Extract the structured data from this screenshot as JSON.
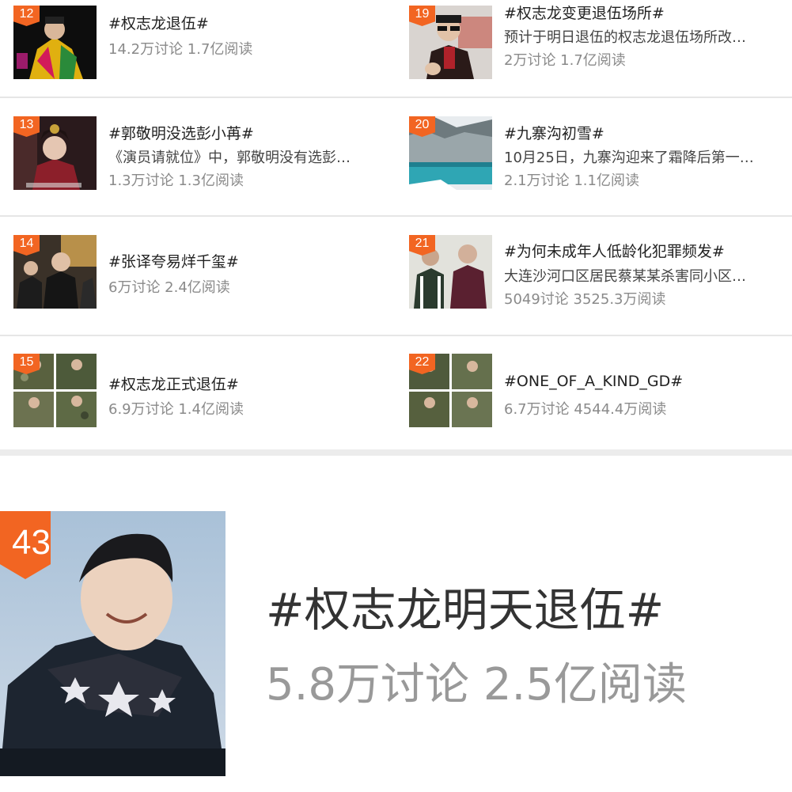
{
  "topics": [
    {
      "rank": "12",
      "title": "#权志龙退伍#",
      "desc": "",
      "stats": "14.2万讨论 1.7亿阅读"
    },
    {
      "rank": "19",
      "title": "#权志龙变更退伍场所#",
      "desc": "预计于明日退伍的权志龙退伍场所改…",
      "stats": "2万讨论 1.7亿阅读"
    },
    {
      "rank": "13",
      "title": "#郭敬明没选彭小苒#",
      "desc": "《演员请就位》中，郭敬明没有选彭…",
      "stats": "1.3万讨论 1.3亿阅读"
    },
    {
      "rank": "20",
      "title": "#九寨沟初雪#",
      "desc": "10月25日，九寨沟迎来了霜降后第一…",
      "stats": "2.1万讨论 1.1亿阅读"
    },
    {
      "rank": "14",
      "title": "#张译夸易烊千玺#",
      "desc": "",
      "stats": "6万讨论 2.4亿阅读"
    },
    {
      "rank": "21",
      "title": "#为何未成年人低龄化犯罪频发#",
      "desc": "大连沙河口区居民蔡某某杀害同小区…",
      "stats": "5049讨论 3525.3万阅读"
    },
    {
      "rank": "15",
      "title": "#权志龙正式退伍#",
      "desc": "",
      "stats": "6.9万讨论 1.4亿阅读"
    },
    {
      "rank": "22",
      "title": "#ONE_OF_A_KIND_GD#",
      "desc": "",
      "stats": "6.7万讨论 4544.4万阅读"
    }
  ],
  "feature": {
    "rank": "43",
    "title": "#权志龙明天退伍#",
    "stats": "5.8万讨论 2.5亿阅读"
  },
  "colors": {
    "badge": "#f26522"
  }
}
